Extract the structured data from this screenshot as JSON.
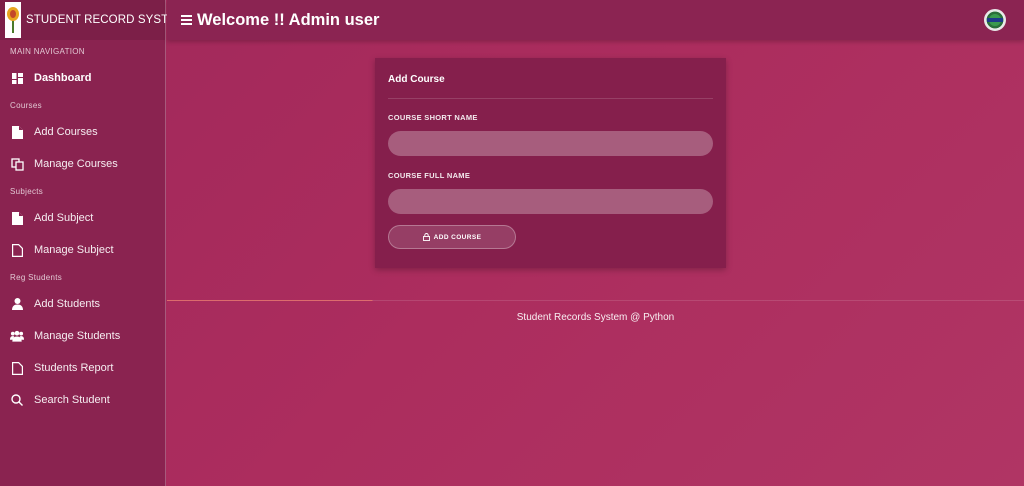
{
  "brand": {
    "title": "STUDENT RECORD SYSTEM",
    "logo_icon": "flower-logo"
  },
  "sidebar": {
    "main_label": "MAIN NAVIGATION",
    "dashboard": "Dashboard",
    "sections": [
      {
        "label": "Courses",
        "items": [
          {
            "label": "Add Courses",
            "icon": "file-icon"
          },
          {
            "label": "Manage Courses",
            "icon": "copy-icon"
          }
        ]
      },
      {
        "label": "Subjects",
        "items": [
          {
            "label": "Add Subject",
            "icon": "file-icon"
          },
          {
            "label": "Manage Subject",
            "icon": "file-outline-icon"
          }
        ]
      },
      {
        "label": "Reg Students",
        "items": [
          {
            "label": "Add Students",
            "icon": "user-icon"
          },
          {
            "label": "Manage Students",
            "icon": "users-icon"
          },
          {
            "label": "Students Report",
            "icon": "file-outline-icon"
          },
          {
            "label": "Search Student",
            "icon": "search-icon"
          }
        ]
      }
    ]
  },
  "header": {
    "title": "Welcome !! Admin user",
    "avatar_icon": "admin-avatar"
  },
  "card": {
    "title": "Add Course",
    "short_name_label": "COURSE SHORT NAME",
    "short_name_value": "",
    "full_name_label": "COURSE FULL NAME",
    "full_name_value": "",
    "submit_label": "ADD COURSE",
    "submit_icon": "lock-icon"
  },
  "footer": {
    "text": "Student Records System @ Python"
  },
  "colors": {
    "background": "#ac2d5e",
    "sidebar": "#8a2350",
    "header": "#8b2452",
    "card": "#851f4c"
  }
}
